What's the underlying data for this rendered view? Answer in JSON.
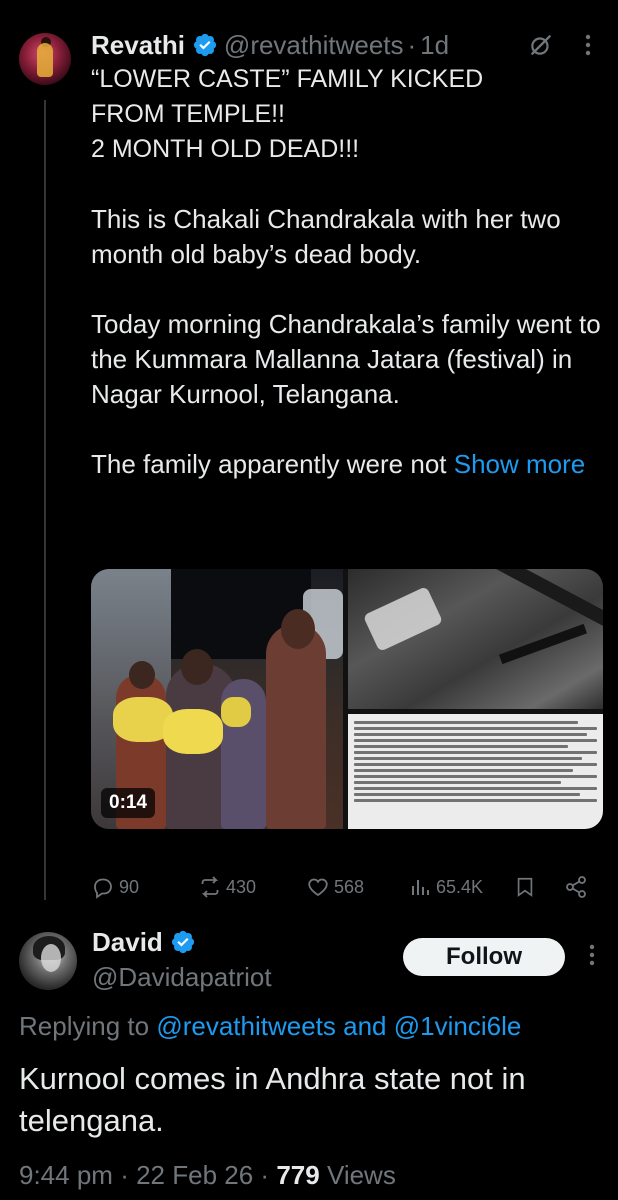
{
  "tweet1": {
    "name": "Revathi",
    "handle": "@revathitweets",
    "time": "1d",
    "separator": "·",
    "text_lines": [
      "“LOWER CASTE” FAMILY KICKED",
      "FROM TEMPLE!!",
      "2 MONTH OLD DEAD!!!"
    ],
    "para2": "This is Chakali Chandrakala with her two month old baby’s dead body.",
    "para3": "Today morning Chandrakala’s family went to the Kummara Mallanna Jatara (festival) in Nagar Kurnool, Telangana.",
    "para4": "The family apparently were not",
    "show_more": "Show more",
    "video_duration": "0:14",
    "stats": {
      "replies": "90",
      "reposts": "430",
      "likes": "568",
      "views": "65.4K"
    }
  },
  "tweet2": {
    "name": "David",
    "handle": "@Davidapatriot",
    "follow_label": "Follow",
    "replying_prefix": "Replying to",
    "replying_mention1": "@revathitweets",
    "replying_and": "and",
    "replying_mention2": "@1vinci6le",
    "text": "Kurnool comes in Andhra state not in telengana.",
    "time": "9:44 pm",
    "date": "22 Feb 26",
    "views_count": "779",
    "views_label": "Views",
    "separator": "·"
  },
  "colors": {
    "background": "#000000",
    "text": "#e7e9ea",
    "muted": "#71767b",
    "accent": "#1d9bf0",
    "follow_bg": "#eff3f4"
  }
}
